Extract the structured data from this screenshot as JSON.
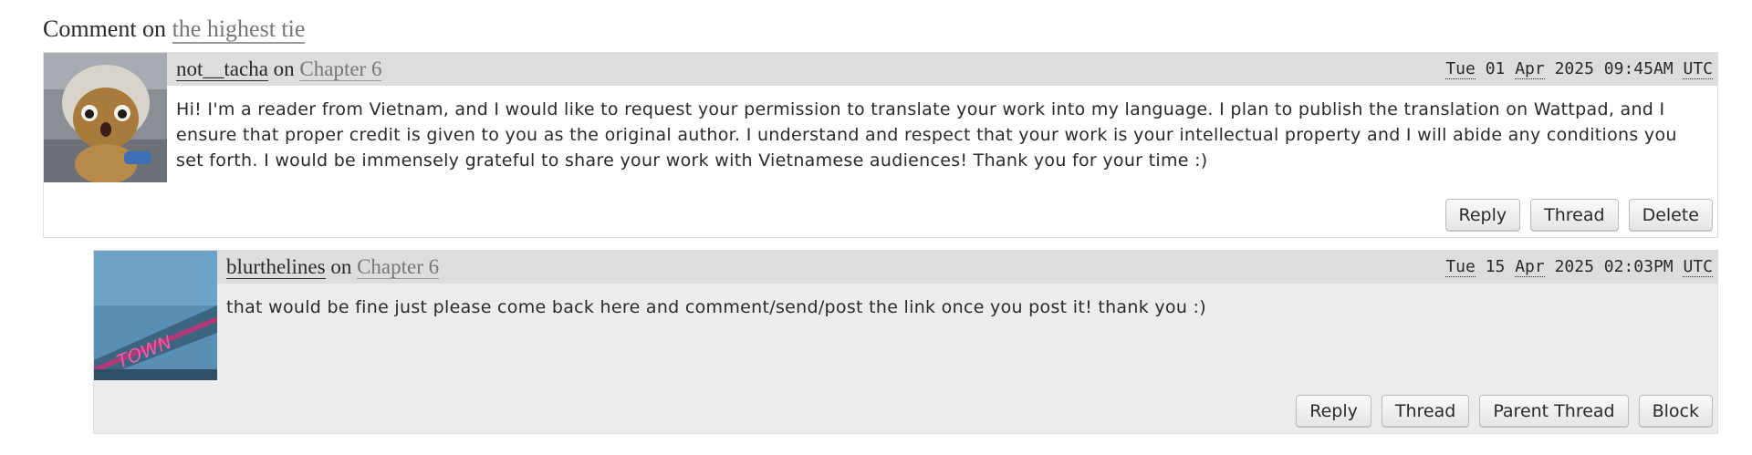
{
  "heading": {
    "prefix": "Comment on",
    "work_title": "the highest tie"
  },
  "comments": [
    {
      "username": "not__tacha",
      "on_label": "on",
      "chapter": "Chapter 6",
      "date": {
        "weekday": "Tue",
        "day": "01",
        "month": "Apr",
        "year": "2025",
        "time": "09:45AM",
        "tz": "UTC"
      },
      "text": "Hi! I'm a reader from Vietnam, and I would like to request your permission to translate your work into my language. I plan to publish the translation on Wattpad, and I ensure that proper credit is given to you as the original author. I understand and respect that your work is your intellectual property and I will abide any conditions you set forth. I would be immensely grateful to share your work with Vietnamese audiences! Thank you for your time :)",
      "actions": [
        "Reply",
        "Thread",
        "Delete"
      ],
      "avatar_icon": "plush-toy-avatar"
    },
    {
      "username": "blurthelines",
      "on_label": "on",
      "chapter": "Chapter 6",
      "date": {
        "weekday": "Tue",
        "day": "15",
        "month": "Apr",
        "year": "2025",
        "time": "02:03PM",
        "tz": "UTC"
      },
      "text": "that would be fine just please come back here and comment/send/post the link once you post it! thank you :)",
      "actions": [
        "Reply",
        "Thread",
        "Parent Thread",
        "Block"
      ],
      "avatar_icon": "neon-sign-avatar"
    }
  ]
}
